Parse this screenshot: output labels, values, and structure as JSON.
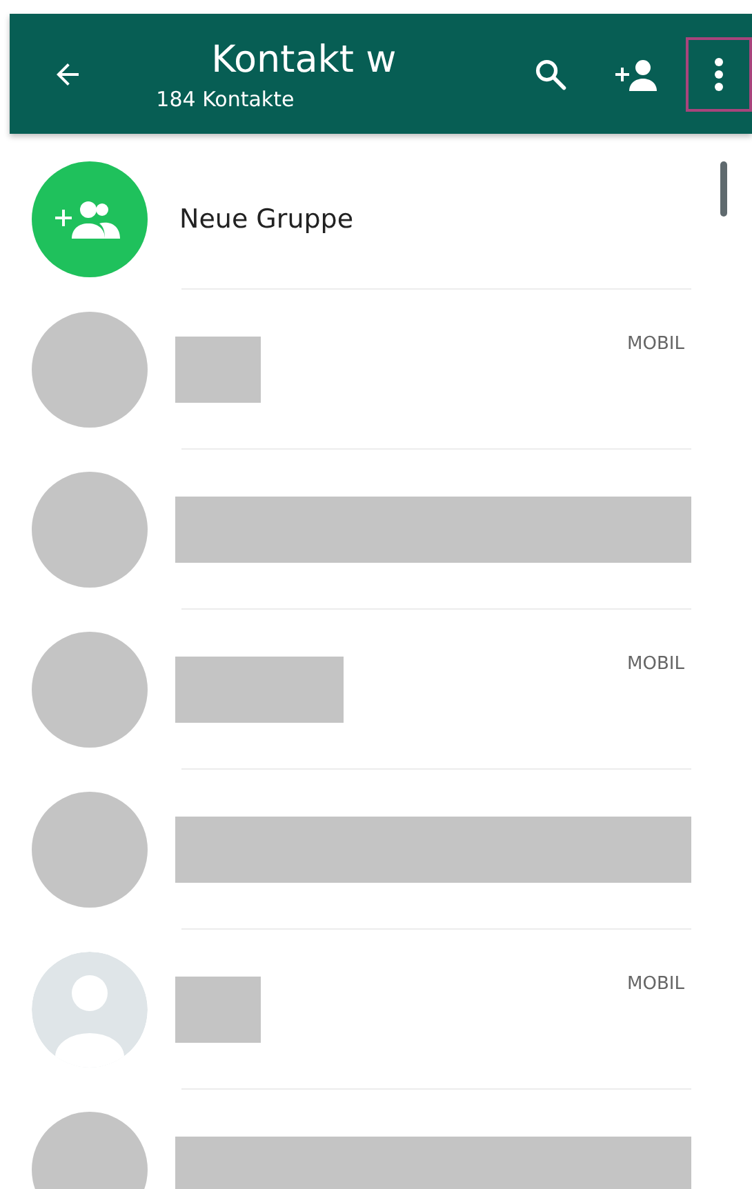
{
  "header": {
    "title": "Kontakt w",
    "subtitle": "184 Kontakte",
    "menu_highlighted": true
  },
  "new_group": {
    "label": "Neue Gruppe"
  },
  "contacts": [
    {
      "kind": "blank",
      "name": {
        "kind": "short"
      },
      "label": "MOBIL"
    },
    {
      "kind": "blank",
      "name": {
        "kind": "long"
      }
    },
    {
      "kind": "blank",
      "name": {
        "kind": "medium"
      },
      "label": "MOBIL"
    },
    {
      "kind": "blank",
      "name": {
        "kind": "long"
      }
    },
    {
      "kind": "default",
      "name": {
        "kind": "short"
      },
      "label": "MOBIL"
    },
    {
      "kind": "blank",
      "name": {
        "kind": "long"
      }
    }
  ]
}
